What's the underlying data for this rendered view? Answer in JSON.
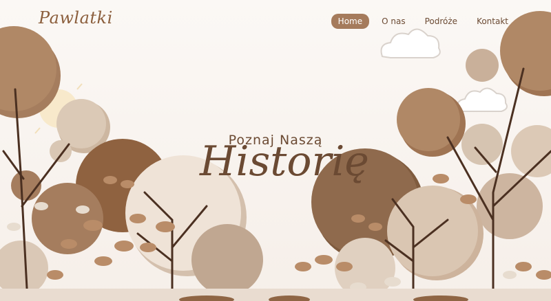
{
  "brand": {
    "name": "Pawlatki"
  },
  "nav": {
    "items": [
      {
        "label": "Home",
        "active": true
      },
      {
        "label": "O nas",
        "active": false
      },
      {
        "label": "Podróże",
        "active": false
      },
      {
        "label": "Kontakt",
        "active": false
      }
    ]
  },
  "hero": {
    "subtitle": "Poznaj Naszą",
    "title": "Historię"
  },
  "colors": {
    "accent": "#a57b5c",
    "dark_brown": "#6b4a33",
    "tree_light": "#e4d6c8",
    "tree_mid": "#c0a78e",
    "tree_dark": "#8f6544",
    "branch": "#4b3021"
  }
}
